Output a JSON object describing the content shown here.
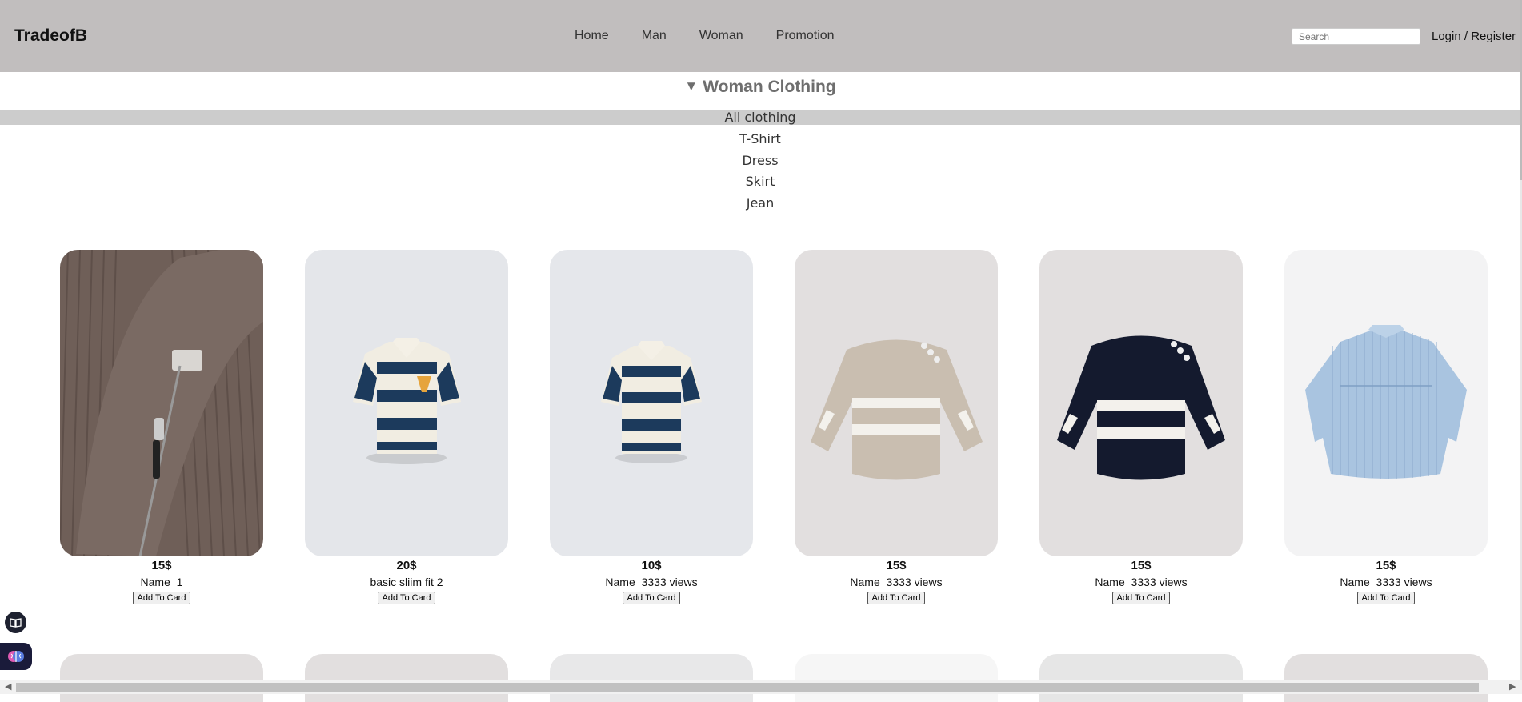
{
  "header": {
    "logo": "TradeofB",
    "nav": [
      "Home",
      "Man",
      "Woman",
      "Promotion"
    ],
    "search_placeholder": "Search",
    "login_label": "Login / Register"
  },
  "category": {
    "title": "Woman Clothing",
    "items": [
      "All clothing",
      "T-Shirt",
      "Dress",
      "Skirt",
      "Jean"
    ],
    "active_index": 0
  },
  "products": [
    {
      "price": "15$",
      "name": "Name_1",
      "button": "Add To Card",
      "image": "brown-zip-sweater"
    },
    {
      "price": "20$",
      "name": "basic sliim fit 2",
      "button": "Add To Card",
      "image": "striped-polo-logo"
    },
    {
      "price": "10$",
      "name": "Name_3333 views",
      "button": "Add To Card",
      "image": "striped-polo"
    },
    {
      "price": "15$",
      "name": "Name_3333 views",
      "button": "Add To Card",
      "image": "beige-striped-sweater"
    },
    {
      "price": "15$",
      "name": "Name_3333 views",
      "button": "Add To Card",
      "image": "navy-striped-sweater"
    },
    {
      "price": "15$",
      "name": "Name_3333 views",
      "button": "Add To Card",
      "image": "blue-striped-shirt"
    }
  ],
  "colors": {
    "header_bg": "#c1bebe",
    "active_category_bg": "#cccccc"
  }
}
